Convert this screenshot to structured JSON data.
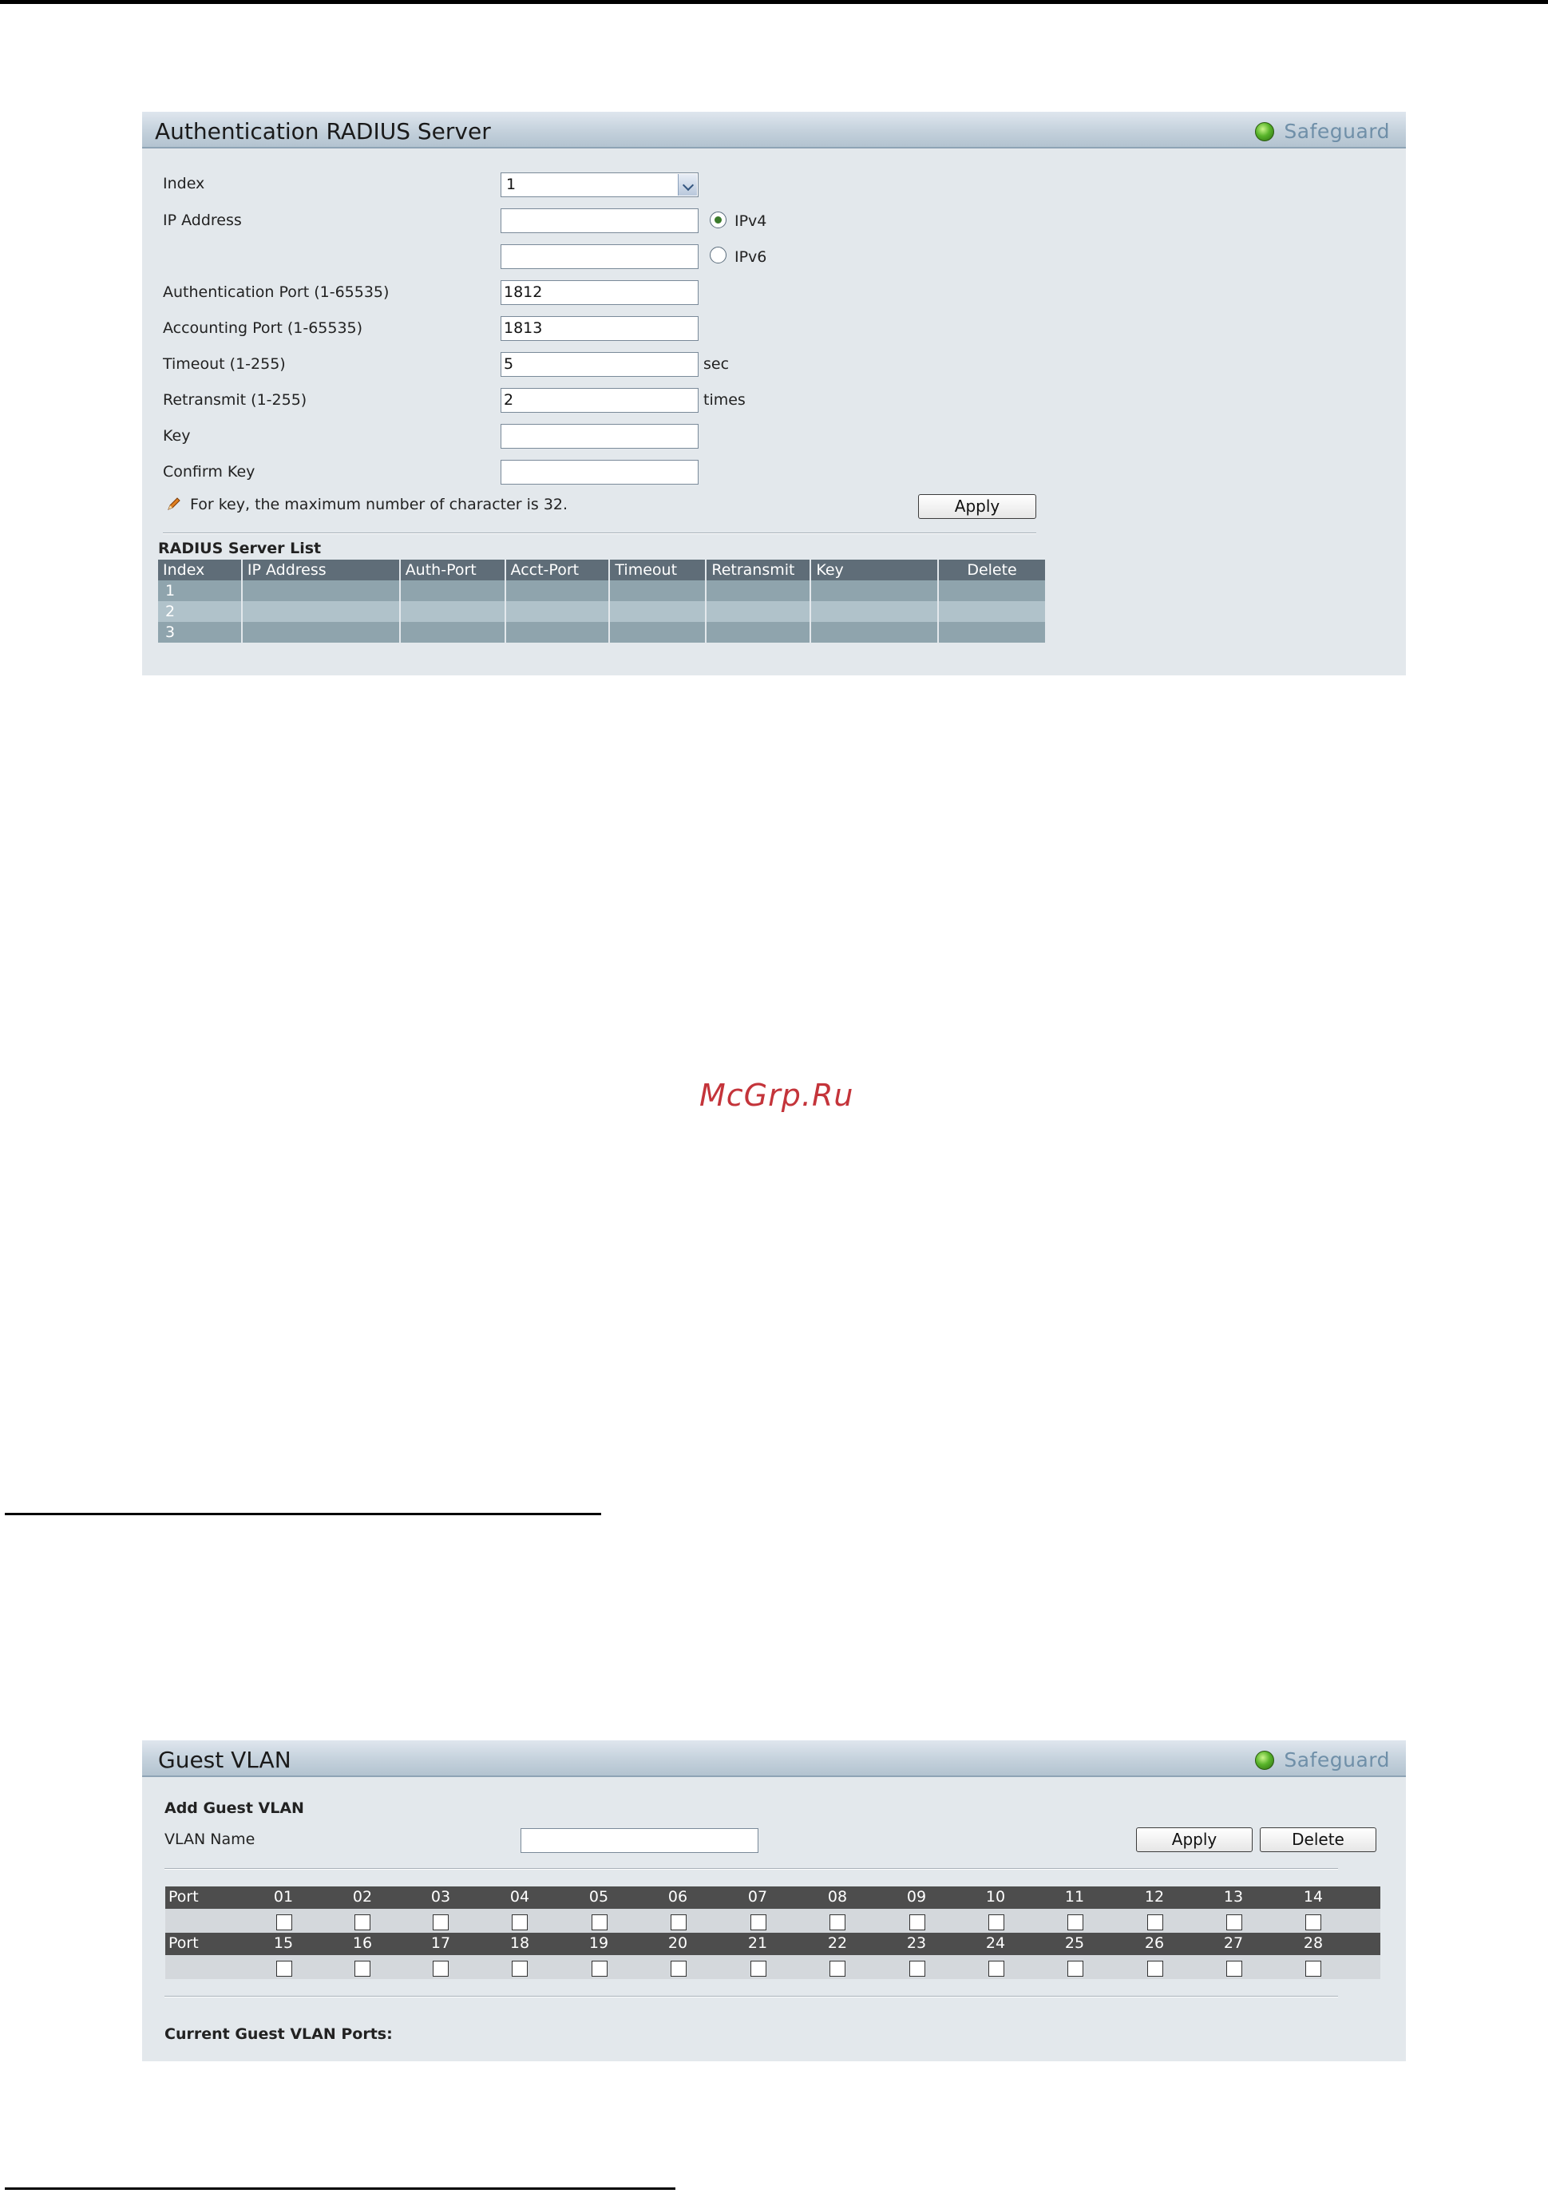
{
  "watermark": "McGrp.Ru",
  "radius_panel": {
    "title": "Authentication RADIUS Server",
    "safeguard": "Safeguard",
    "fields": {
      "index_label": "Index",
      "index_value": "1",
      "ip_label": "IP Address",
      "ipv4_value": "",
      "ipv4_label": "IPv4",
      "ipv6_value": "",
      "ipv6_label": "IPv6",
      "auth_port_label": "Authentication Port (1-65535)",
      "auth_port_value": "1812",
      "acct_port_label": "Accounting Port (1-65535)",
      "acct_port_value": "1813",
      "timeout_label": "Timeout (1-255)",
      "timeout_value": "5",
      "timeout_unit": "sec",
      "retransmit_label": "Retransmit (1-255)",
      "retransmit_value": "2",
      "retransmit_unit": "times",
      "key_label": "Key",
      "key_value": "",
      "confirm_key_label": "Confirm Key",
      "confirm_key_value": ""
    },
    "note": "For key, the maximum number of character is 32.",
    "apply_label": "Apply",
    "list": {
      "title": "RADIUS Server List",
      "columns": [
        "Index",
        "IP Address",
        "Auth-Port",
        "Acct-Port",
        "Timeout",
        "Retransmit",
        "Key",
        "Delete"
      ],
      "rows": [
        [
          "1",
          "",
          "",
          "",
          "",
          "",
          "",
          ""
        ],
        [
          "2",
          "",
          "",
          "",
          "",
          "",
          "",
          ""
        ],
        [
          "3",
          "",
          "",
          "",
          "",
          "",
          "",
          ""
        ]
      ]
    }
  },
  "guest_panel": {
    "title": "Guest VLAN",
    "safeguard": "Safeguard",
    "section": "Add Guest VLAN",
    "vlan_name_label": "VLAN Name",
    "vlan_name_value": "",
    "apply_label": "Apply",
    "delete_label": "Delete",
    "port_label": "Port",
    "ports_row1": [
      "01",
      "02",
      "03",
      "04",
      "05",
      "06",
      "07",
      "08",
      "09",
      "10",
      "11",
      "12",
      "13",
      "14"
    ],
    "ports_row2": [
      "15",
      "16",
      "17",
      "18",
      "19",
      "20",
      "21",
      "22",
      "23",
      "24",
      "25",
      "26",
      "27",
      "28"
    ],
    "current_label": "Current Guest VLAN Ports:"
  }
}
